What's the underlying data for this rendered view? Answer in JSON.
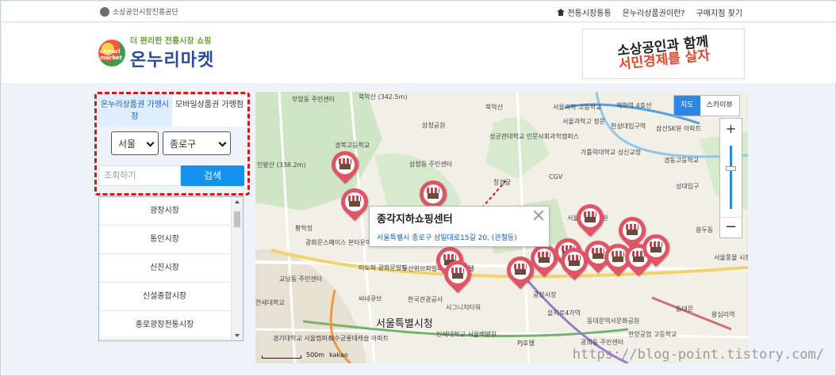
{
  "topbar": {
    "agency": "소상공인시장진흥공단",
    "links": [
      "전통시장통통",
      "온누리상품권이란?",
      "구매지점 찾기"
    ]
  },
  "header": {
    "tagline": "더 편리한 전통시장 쇼핑",
    "logo_name": "온누리마켓",
    "logo_mark": "onnuri market",
    "banner": {
      "line1": "소상공인과 함께",
      "line2": "서민경제를 살자"
    }
  },
  "panel": {
    "tabs": [
      {
        "label": "온누리상품권 가맹시장",
        "active": true
      },
      {
        "label": "모바일상품권 가맹점",
        "active": false
      }
    ],
    "city": "서울",
    "district": "종로구",
    "search_placeholder": "조회하기",
    "search_button": "검색"
  },
  "markets": [
    "광장시장",
    "통인시장",
    "신진시장",
    "신설종합시장",
    "종로광장전통시장"
  ],
  "map": {
    "type_buttons": [
      "지도",
      "스카이뷰"
    ],
    "zoom_in": "+",
    "zoom_out": "−",
    "popup": {
      "title": "종각지하쇼핑센터",
      "address": "서울특별시 종로구 삼일대로15길 20, (관철동)"
    },
    "scale": "500m",
    "brand": "kakao",
    "labels": [
      "부암동 주민센터",
      "북악산 (342.5m)",
      "북악산",
      "서울과학 고등학교",
      "서울과학고 정문",
      "혜화역 4호선",
      "삼청공원",
      "성균관대학교 인문사회과학캠퍼스",
      "한성대입구역",
      "삼선SK뷰 아파트",
      "경복고등학교",
      "삼청동 주민센터",
      "가톨릭대학교 성신교정",
      "경동고등학교",
      "CGV",
      "성대입구",
      "인왕산 (338.2m)",
      "창경궁",
      "서울대학교병원",
      "동대문",
      "황학정",
      "광화문스페이스 본타운아파트",
      "미도파 광화문빌딩",
      "두산위브파빌리온 오피스텔",
      "씨네큐브",
      "교남동 주민센터",
      "연세대학교",
      "한국관광공사",
      "시그니처타워",
      "광장시장",
      "을지로4가역",
      "동대문역사문화공원",
      "서울특별시청",
      "경기대학교 서울캠퍼스",
      "덕수궁롯데캐슬 아파트",
      "인제대학교 서울백병원",
      "PJ호텔",
      "광희동 주민센터",
      "한양공업 고등학교",
      "왕십리역",
      "서울풍물 시장",
      "용두동"
    ]
  },
  "watermark": "https://blog-point.tistory.com/"
}
